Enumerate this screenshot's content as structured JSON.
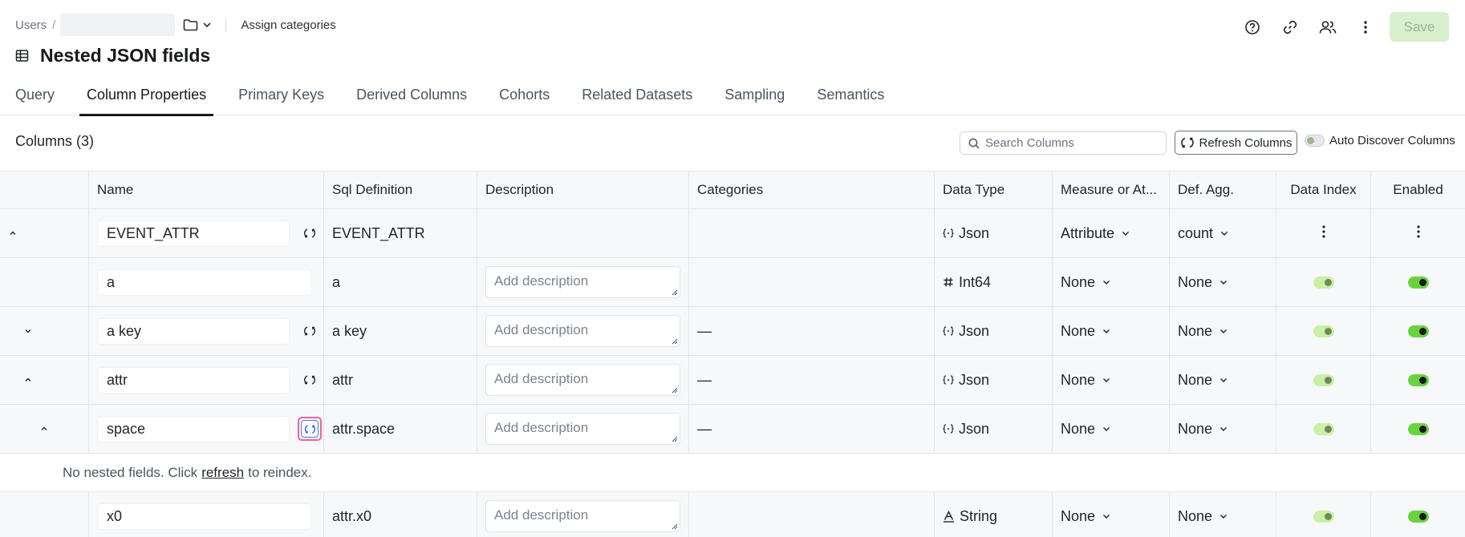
{
  "breadcrumb": {
    "root": "Users",
    "separator": "/",
    "assign_label": "Assign categories"
  },
  "header": {
    "title": "Nested JSON fields",
    "save_label": "Save"
  },
  "tabs": [
    {
      "label": "Query"
    },
    {
      "label": "Column Properties",
      "active": true
    },
    {
      "label": "Primary Keys"
    },
    {
      "label": "Derived Columns"
    },
    {
      "label": "Cohorts"
    },
    {
      "label": "Related Datasets"
    },
    {
      "label": "Sampling"
    },
    {
      "label": "Semantics"
    }
  ],
  "columns_panel": {
    "title": "Columns (3)",
    "search_placeholder": "Search Columns",
    "refresh_label": "Refresh Columns",
    "auto_discover_label": "Auto Discover Columns"
  },
  "table": {
    "headers": [
      "Name",
      "Sql Definition",
      "Description",
      "Categories",
      "Data Type",
      "Measure or At...",
      "Def. Agg.",
      "Data Index",
      "Enabled"
    ],
    "rows": [
      {
        "name": "EVENT_ATTR",
        "sql": "EVENT_ATTR",
        "description": "",
        "categories": "",
        "dtype": "Json",
        "measure": "Attribute",
        "agg": "count"
      },
      {
        "name": "a",
        "sql": "a",
        "description_placeholder": "Add description",
        "categories": "",
        "dtype": "Int64",
        "measure": "None",
        "agg": "None"
      },
      {
        "name": "a key",
        "sql": "a key",
        "description_placeholder": "Add description",
        "categories": "—",
        "dtype": "Json",
        "measure": "None",
        "agg": "None"
      },
      {
        "name": "attr",
        "sql": "attr",
        "description_placeholder": "Add description",
        "categories": "—",
        "dtype": "Json",
        "measure": "None",
        "agg": "None"
      },
      {
        "name": "space",
        "sql": "attr.space",
        "description_placeholder": "Add description",
        "categories": "—",
        "dtype": "Json",
        "measure": "None",
        "agg": "None"
      },
      {
        "name": "x0",
        "sql": "attr.x0",
        "description_placeholder": "Add description",
        "categories": "",
        "dtype": "String",
        "measure": "None",
        "agg": "None"
      }
    ],
    "note": {
      "prefix": "No nested fields. Click",
      "link": "refresh",
      "suffix": "to reindex."
    }
  },
  "colors": {
    "accent": "#17191c",
    "save_bg": "#d7efcc",
    "toggle_on": "#67d43d",
    "toggle_off": "#c9f0a6",
    "focus": "#f0629a"
  }
}
